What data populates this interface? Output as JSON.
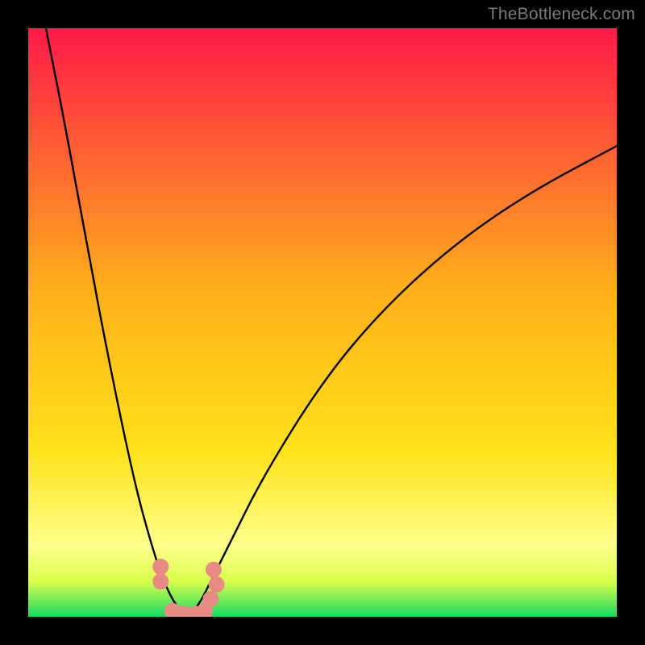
{
  "watermark": "TheBottleneck.com",
  "chart_data": {
    "type": "line",
    "title": "",
    "xlabel": "",
    "ylabel": "",
    "xlim": [
      0,
      1
    ],
    "ylim": [
      0,
      1
    ],
    "background_gradient": {
      "top": "#ff1a4a",
      "mid": "#ffe21a",
      "band": "#ffff8c",
      "bottom": "#18d860"
    },
    "curve": {
      "description": "V-shaped bottleneck curve, asymmetric — steep descent on the left, shallower rise on the right, minimum near x≈0.27",
      "x": [
        0.03,
        0.06,
        0.1,
        0.14,
        0.18,
        0.21,
        0.23,
        0.25,
        0.27,
        0.29,
        0.31,
        0.34,
        0.4,
        0.5,
        0.6,
        0.72,
        0.85,
        1.0
      ],
      "y": [
        1.0,
        0.85,
        0.63,
        0.42,
        0.23,
        0.12,
        0.06,
        0.02,
        0.0,
        0.02,
        0.06,
        0.12,
        0.24,
        0.4,
        0.52,
        0.63,
        0.72,
        0.8
      ]
    },
    "markers": {
      "description": "Cluster of salmon dots near the curve minimum",
      "x": [
        0.225,
        0.225,
        0.245,
        0.265,
        0.285,
        0.3,
        0.31,
        0.32,
        0.315
      ],
      "y": [
        0.085,
        0.06,
        0.01,
        0.005,
        0.005,
        0.01,
        0.03,
        0.055,
        0.08
      ],
      "color": "#e88b84"
    }
  }
}
